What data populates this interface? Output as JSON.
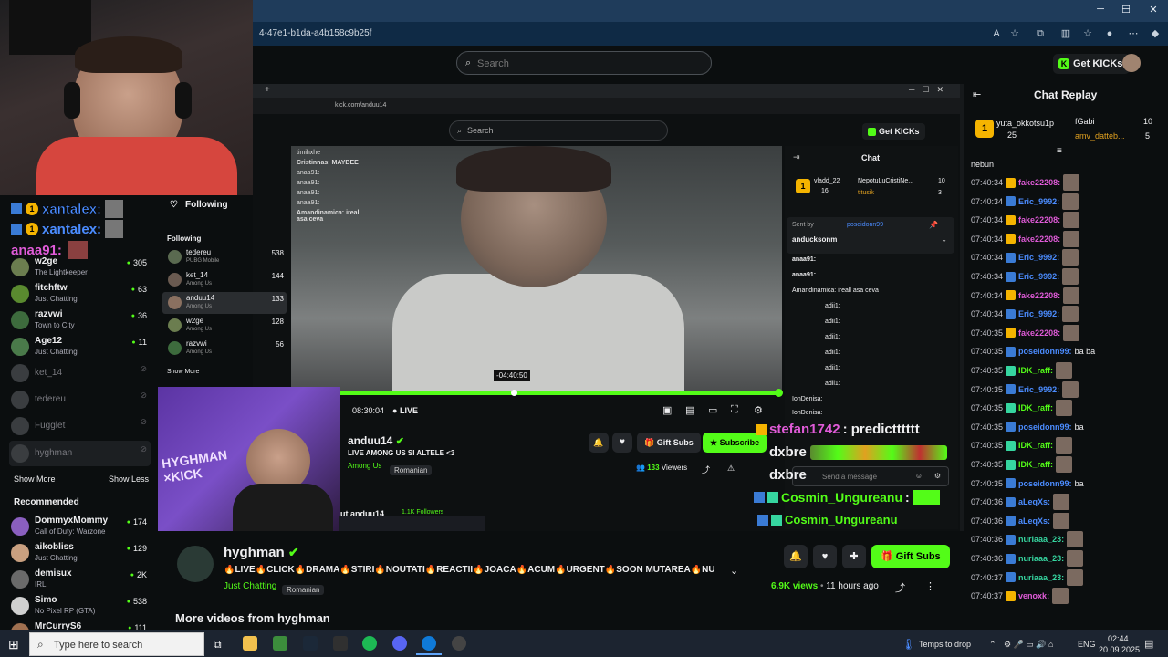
{
  "browser": {
    "url_fragment": "4-47e1-b1da-a4b158c9b25f",
    "window_min": "─",
    "window_max": "☐",
    "window_close": "✕"
  },
  "header": {
    "search_placeholder": "Search",
    "get_kicks_label": "Get KICKs"
  },
  "facecam_overlay": {
    "chat_lines": [
      {
        "user": "xantalex:",
        "badge": "1"
      },
      {
        "user": "xantalex:",
        "badge": "1"
      },
      {
        "user": "anaa91:"
      }
    ]
  },
  "sidebar": {
    "channels": [
      {
        "name": "w2ge",
        "category": "The Lightkeeper",
        "viewers": "305"
      },
      {
        "name": "fitchftw",
        "category": "Just Chatting",
        "viewers": "63"
      },
      {
        "name": "razvwi",
        "category": "Town to City",
        "viewers": "36"
      },
      {
        "name": "Age12",
        "category": "Just Chatting",
        "viewers": "11"
      }
    ],
    "offline": [
      {
        "name": "ket_14"
      },
      {
        "name": "tedereu"
      },
      {
        "name": "Fugglet"
      },
      {
        "name": "hyghman"
      }
    ],
    "show_more": "Show More",
    "show_less": "Show Less",
    "recommended_title": "Recommended",
    "recommended": [
      {
        "name": "DommyxMommy",
        "category": "Call of Duty: Warzone",
        "viewers": "174"
      },
      {
        "name": "aikobliss",
        "category": "Just Chatting",
        "viewers": "129"
      },
      {
        "name": "demisux",
        "category": "IRL",
        "viewers": "2K"
      },
      {
        "name": "Simo",
        "category": "No Pixel RP (GTA)",
        "viewers": "538"
      },
      {
        "name": "MrCurryS6",
        "category": "",
        "viewers": "111"
      }
    ]
  },
  "inner_page": {
    "url": "kick.com/anduu14",
    "search_placeholder": "Search",
    "get_kicks": "Get KICKs",
    "following_label": "Following",
    "following_title": "Following",
    "following": [
      {
        "name": "tedereu",
        "category": "PUBG Mobile",
        "viewers": "538"
      },
      {
        "name": "ket_14",
        "category": "Among Us",
        "viewers": "144"
      },
      {
        "name": "anduu14",
        "category": "Among Us",
        "viewers": "133"
      },
      {
        "name": "w2ge",
        "category": "Among Us",
        "viewers": "128"
      },
      {
        "name": "razvwi",
        "category": "Among Us",
        "viewers": "56"
      }
    ],
    "show_more": "Show More",
    "overlay_chat": [
      "timihxhe",
      "Cristinnas: MAYBEE",
      "anaa91:",
      "anaa91:",
      "anaa91:",
      "anaa91:",
      "Amandinamica: ireall asa ceva"
    ],
    "time_hover": "-04:40:50",
    "time_current": "08:30:04",
    "live_label": "LIVE",
    "streamer_name": "anduu14",
    "stream_title": "LIVE AMONG US SI ALTELE <3",
    "category": "Among Us",
    "language": "Romanian",
    "gift_subs": "Gift Subs",
    "subscribe": "Subscribe",
    "viewers_count": "133",
    "viewers_label": "Viewers",
    "bottom_text": "ut anduu14",
    "followers": "1.1K Followers",
    "chat_title": "Chat",
    "chat_top": [
      {
        "name": "vladd_22",
        "value": "16"
      },
      {
        "name": "NepotuLuCristiNe...",
        "value": "10"
      },
      {
        "name": "titusik",
        "value": "3"
      }
    ],
    "sent_by_label": "Sent by",
    "sent_by_user": "poseidonn99",
    "pinned_user": "anducksonm",
    "chat_lines": [
      "anaa91:",
      "anaa91:",
      "Amandinamica: ireall asa ceva",
      "adii1:",
      "adii1:",
      "adii1:",
      "adii1:",
      "adii1:",
      "adii1:",
      "IonDenisa:",
      "IonDenisa:"
    ],
    "send_placeholder": "Send a message",
    "overlay_big": [
      {
        "user": "stefan1742",
        "msg": ": predictttttt"
      },
      {
        "user": "dxbre",
        "msg": ""
      },
      {
        "user": "dxbre",
        "msg": ""
      },
      {
        "user": "Cosmin_Ungureanu",
        "msg": ":"
      },
      {
        "user": "Cosmin_Ungureanu",
        "msg": ""
      }
    ]
  },
  "stream": {
    "channel": "hyghman",
    "title": "🔥LIVE🔥CLICK🔥DRAMA🔥STIRI🔥NOUTATI🔥REACTII🔥JOACA🔥ACUM🔥URGENT🔥SOON MUTAREA🔥NU MAI E ...",
    "category": "Just Chatting",
    "language": "Romanian",
    "views": "6.9K",
    "views_label": "views",
    "age": "11 hours ago",
    "gift_subs": "Gift Subs",
    "more_videos": "More videos from hyghman"
  },
  "chat_replay": {
    "title": "Chat Replay",
    "leaders": [
      {
        "name": "yuta_okkotsu1p",
        "value": "25"
      },
      {
        "name": "fGabi",
        "value": "10"
      },
      {
        "name": "amv_datteb...",
        "value": "5"
      }
    ],
    "first_line": "nebun",
    "messages": [
      {
        "time": "07:40:34",
        "user": "fake22208:",
        "color": "#e05bd8",
        "msg": ""
      },
      {
        "time": "07:40:34",
        "user": "Eric_9992:",
        "color": "#4b8cff",
        "msg": ""
      },
      {
        "time": "07:40:34",
        "user": "fake22208:",
        "color": "#e05bd8",
        "msg": ""
      },
      {
        "time": "07:40:34",
        "user": "fake22208:",
        "color": "#e05bd8",
        "msg": ""
      },
      {
        "time": "07:40:34",
        "user": "Eric_9992:",
        "color": "#4b8cff",
        "msg": ""
      },
      {
        "time": "07:40:34",
        "user": "Eric_9992:",
        "color": "#4b8cff",
        "msg": ""
      },
      {
        "time": "07:40:34",
        "user": "fake22208:",
        "color": "#e05bd8",
        "msg": ""
      },
      {
        "time": "07:40:34",
        "user": "Eric_9992:",
        "color": "#4b8cff",
        "msg": ""
      },
      {
        "time": "07:40:35",
        "user": "fake22208:",
        "color": "#e05bd8",
        "msg": ""
      },
      {
        "time": "07:40:35",
        "user": "poseidonn99:",
        "color": "#4b8cff",
        "msg": "ba ba"
      },
      {
        "time": "07:40:35",
        "user": "IDK_raff:",
        "color": "#53fc18",
        "msg": ""
      },
      {
        "time": "07:40:35",
        "user": "Eric_9992:",
        "color": "#4b8cff",
        "msg": ""
      },
      {
        "time": "07:40:35",
        "user": "IDK_raff:",
        "color": "#53fc18",
        "msg": ""
      },
      {
        "time": "07:40:35",
        "user": "poseidonn99:",
        "color": "#4b8cff",
        "msg": "ba"
      },
      {
        "time": "07:40:35",
        "user": "IDK_raff:",
        "color": "#53fc18",
        "msg": ""
      },
      {
        "time": "07:40:35",
        "user": "IDK_raff:",
        "color": "#53fc18",
        "msg": ""
      },
      {
        "time": "07:40:35",
        "user": "poseidonn99:",
        "color": "#4b8cff",
        "msg": "ba"
      },
      {
        "time": "07:40:36",
        "user": "aLeqXs:",
        "color": "#4b8cff",
        "msg": ""
      },
      {
        "time": "07:40:36",
        "user": "aLeqXs:",
        "color": "#4b8cff",
        "msg": ""
      },
      {
        "time": "07:40:36",
        "user": "nuriaaa_23:",
        "color": "#36d6a0",
        "msg": ""
      },
      {
        "time": "07:40:36",
        "user": "nuriaaa_23:",
        "color": "#36d6a0",
        "msg": ""
      },
      {
        "time": "07:40:37",
        "user": "nuriaaa_23:",
        "color": "#36d6a0",
        "msg": ""
      },
      {
        "time": "07:40:37",
        "user": "venoxk:",
        "color": "#e05bd8",
        "msg": ""
      }
    ]
  },
  "taskbar": {
    "search_placeholder": "Type here to search",
    "temps": "Temps to drop",
    "lang": "ENG",
    "time": "02:44",
    "date": "20.09.2025"
  }
}
